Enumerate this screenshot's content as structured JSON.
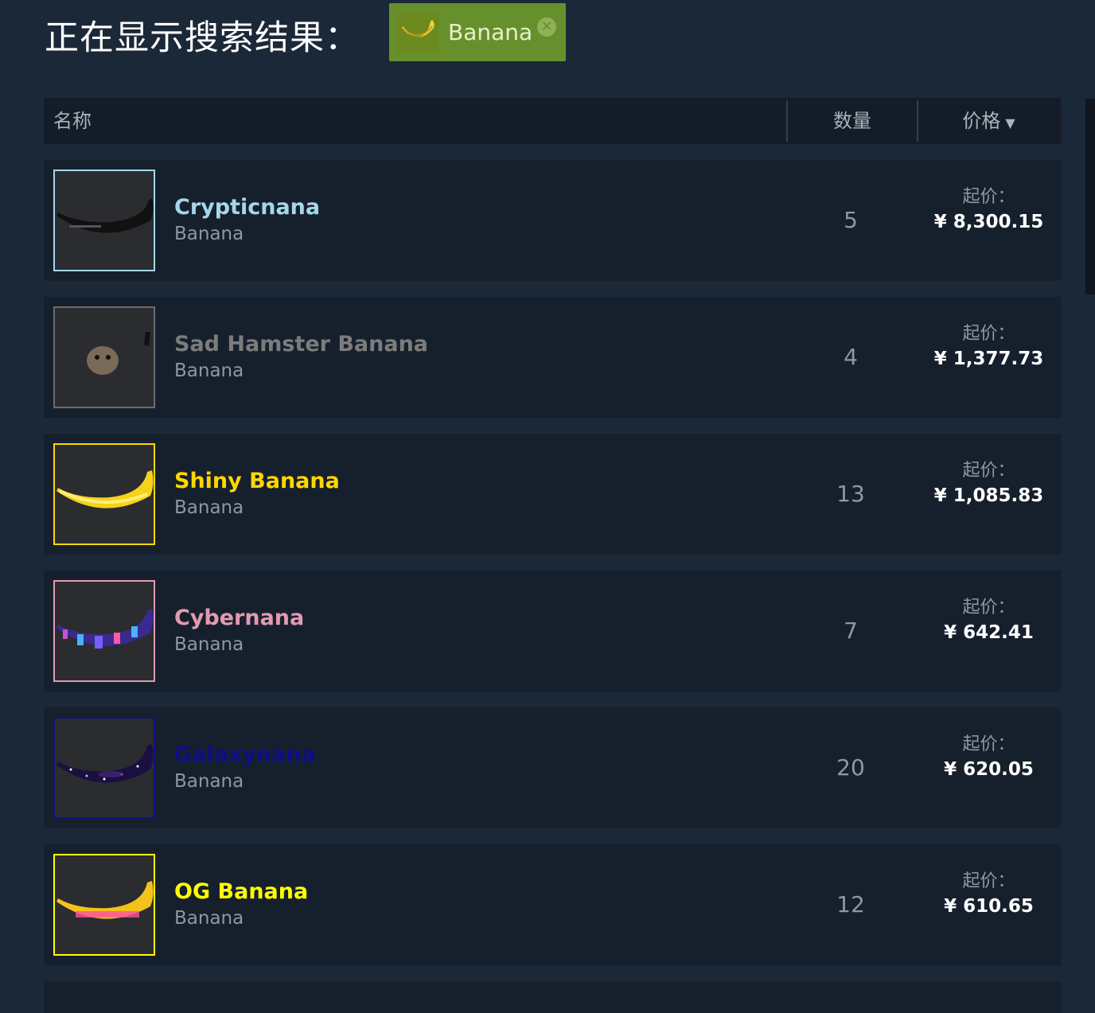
{
  "header": {
    "title": "正在显示搜索结果："
  },
  "filter": {
    "label": "Banana",
    "icon": "banana-icon",
    "close_icon": "close-icon"
  },
  "columns": {
    "name": "名称",
    "quantity": "数量",
    "price": "价格",
    "sort_indicator": "▼"
  },
  "rows": [
    {
      "name": "Crypticnana",
      "game": "Banana",
      "quantity": "5",
      "price_label": "起价：",
      "price": "¥ 8,300.15",
      "name_color": "#a4d7e9",
      "border_color": "#a4d7e9",
      "icon": "dark-banana-icon"
    },
    {
      "name": "Sad Hamster Banana",
      "game": "Banana",
      "quantity": "4",
      "price_label": "起价：",
      "price": "¥ 1,377.73",
      "name_color": "#7c7c7c",
      "border_color": "#6c6c6c",
      "icon": "hamster-icon"
    },
    {
      "name": "Shiny Banana",
      "game": "Banana",
      "quantity": "13",
      "price_label": "起价：",
      "price": "¥ 1,085.83",
      "name_color": "#ffd700",
      "border_color": "#ffd700",
      "icon": "yellow-banana-icon"
    },
    {
      "name": "Cybernana",
      "game": "Banana",
      "quantity": "7",
      "price_label": "起价：",
      "price": "¥ 642.41",
      "name_color": "#e29ab1",
      "border_color": "#e29ab1",
      "icon": "cyber-banana-icon"
    },
    {
      "name": "Galaxynana",
      "game": "Banana",
      "quantity": "20",
      "price_label": "起价：",
      "price": "¥ 620.05",
      "name_color": "#0d0d8a",
      "border_color": "#10107a",
      "icon": "galaxy-banana-icon"
    },
    {
      "name": "OG Banana",
      "game": "Banana",
      "quantity": "12",
      "price_label": "起价：",
      "price": "¥ 610.65",
      "name_color": "#ffff00",
      "border_color": "#ffff00",
      "icon": "og-banana-icon"
    }
  ]
}
